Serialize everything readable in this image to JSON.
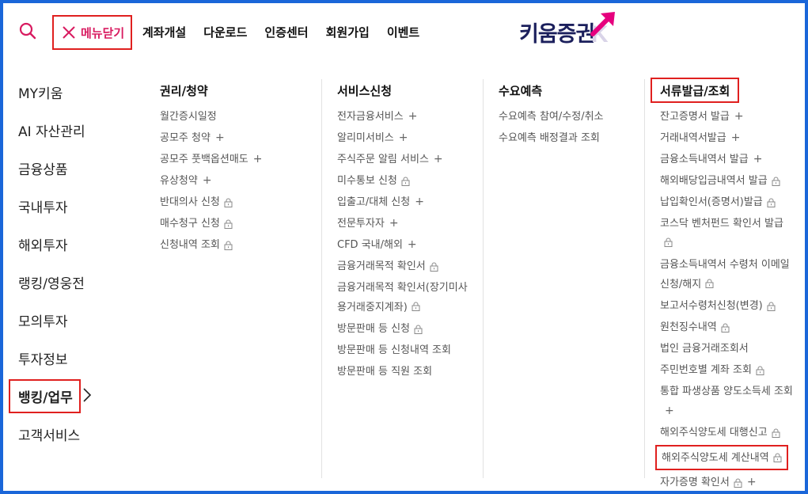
{
  "header": {
    "close_label": "메뉴닫기",
    "nav": [
      "계좌개설",
      "다운로드",
      "인증센터",
      "회원가입",
      "이벤트"
    ],
    "logo_text": "키움증권",
    "logo_letter": "K"
  },
  "left_menu": {
    "items": [
      "MY키움",
      "AI 자산관리",
      "금융상품",
      "국내투자",
      "해외투자",
      "랭킹/영웅전",
      "모의투자",
      "투자정보"
    ],
    "active": "뱅킹/업무",
    "after": [
      "고객서비스"
    ]
  },
  "columns": {
    "c1": {
      "title": "권리/청약",
      "items": [
        {
          "label": "월간증시일정",
          "lock": false,
          "plus": false
        },
        {
          "label": "공모주 청약",
          "lock": false,
          "plus": true
        },
        {
          "label": "공모주 풋백옵션매도",
          "lock": false,
          "plus": true
        },
        {
          "label": "유상청약",
          "lock": false,
          "plus": true
        },
        {
          "label": "반대의사 신청",
          "lock": true,
          "plus": false
        },
        {
          "label": "매수청구 신청",
          "lock": true,
          "plus": false
        },
        {
          "label": "신청내역 조회",
          "lock": true,
          "plus": false
        }
      ]
    },
    "c2": {
      "title": "서비스신청",
      "items": [
        {
          "label": "전자금융서비스",
          "lock": false,
          "plus": true
        },
        {
          "label": "알리미서비스",
          "lock": false,
          "plus": true
        },
        {
          "label": "주식주문 알림 서비스",
          "lock": false,
          "plus": true
        },
        {
          "label": "미수통보 신청",
          "lock": true,
          "plus": false
        },
        {
          "label": "입출고/대체 신청",
          "lock": false,
          "plus": true
        },
        {
          "label": "전문투자자",
          "lock": false,
          "plus": true
        },
        {
          "label": "CFD 국내/해외",
          "lock": false,
          "plus": true
        },
        {
          "label": "금융거래목적 확인서",
          "lock": true,
          "plus": false
        },
        {
          "label": "금융거래목적 확인서(장기미사용거래중지계좌)",
          "lock": true,
          "plus": false
        },
        {
          "label": "방문판매 등 신청",
          "lock": true,
          "plus": false
        },
        {
          "label": "방문판매 등 신청내역 조회",
          "lock": false,
          "plus": false
        },
        {
          "label": "방문판매 등 직원 조회",
          "lock": false,
          "plus": false
        }
      ]
    },
    "c3": {
      "title": "수요예측",
      "items": [
        {
          "label": "수요예측 참여/수정/취소",
          "lock": false,
          "plus": false
        },
        {
          "label": "수요예측 배정결과 조회",
          "lock": false,
          "plus": false
        }
      ]
    },
    "c4": {
      "title": "서류발급/조회",
      "items": [
        {
          "label": "잔고증명서 발급",
          "lock": false,
          "plus": true
        },
        {
          "label": "거래내역서발급",
          "lock": false,
          "plus": true
        },
        {
          "label": "금융소득내역서 발급",
          "lock": false,
          "plus": true
        },
        {
          "label": "해외배당입금내역서 발급",
          "lock": true,
          "plus": false
        },
        {
          "label": "납입확인서(증명서)발급",
          "lock": true,
          "plus": false
        },
        {
          "label": "코스닥 벤처펀드 확인서 발급",
          "lock": true,
          "plus": false
        },
        {
          "label": "금융소득내역서 수령처 이메일 신청/해지",
          "lock": true,
          "plus": false
        },
        {
          "label": "보고서수령처신청(변경)",
          "lock": true,
          "plus": false
        },
        {
          "label": "원천징수내역",
          "lock": true,
          "plus": false
        },
        {
          "label": "법인 금융거래조회서",
          "lock": false,
          "plus": false
        },
        {
          "label": "주민번호별 계좌 조회",
          "lock": true,
          "plus": false
        },
        {
          "label": "통합 파생상품 양도소득세 조회",
          "lock": false,
          "plus": true
        },
        {
          "label": "해외주식양도세 대행신고",
          "lock": true,
          "plus": false
        },
        {
          "label": "해외주식양도세 계산내역",
          "lock": true,
          "plus": false
        },
        {
          "label": "자가증명 확인서",
          "lock": true,
          "plus": true
        }
      ]
    }
  }
}
